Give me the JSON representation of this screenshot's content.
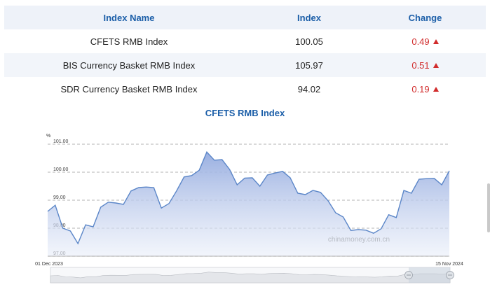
{
  "table": {
    "headers": [
      "Index Name",
      "Index",
      "Change"
    ],
    "rows": [
      {
        "name": "CFETS RMB Index",
        "index": "100.05",
        "change": "0.49"
      },
      {
        "name": "BIS Currency Basket RMB Index",
        "index": "105.97",
        "change": "0.51"
      },
      {
        "name": "SDR Currency Basket RMB Index",
        "index": "94.02",
        "change": "0.19"
      }
    ]
  },
  "colors": {
    "header_text": "#1b5ea8",
    "up": "#d12b2b",
    "line": "#5b86c8",
    "fill_top": "#9db4e3"
  },
  "chart_data": {
    "type": "area",
    "title": "CFETS RMB Index",
    "ylabel": "%",
    "ylim": [
      97.0,
      101.0
    ],
    "yticks": [
      "101.00",
      "100.00",
      "99.00",
      "98.00",
      "97.00"
    ],
    "x_start_label": "01 Dec 2023",
    "x_end_label": "15 Nov 2024",
    "watermark": "chinamoney.com.cn",
    "grid": true,
    "y": [
      98.6,
      98.82,
      98.0,
      97.9,
      97.45,
      98.12,
      98.05,
      98.75,
      98.93,
      98.9,
      98.85,
      99.33,
      99.45,
      99.47,
      99.45,
      98.72,
      98.88,
      99.33,
      99.83,
      99.88,
      100.07,
      100.72,
      100.43,
      100.45,
      100.1,
      99.55,
      99.79,
      99.8,
      99.5,
      99.9,
      99.97,
      100.03,
      99.8,
      99.25,
      99.2,
      99.35,
      99.28,
      98.98,
      98.55,
      98.4,
      97.92,
      97.95,
      97.93,
      97.82,
      97.98,
      98.48,
      98.38,
      99.35,
      99.25,
      99.75,
      99.77,
      99.78,
      99.55,
      100.05
    ]
  }
}
